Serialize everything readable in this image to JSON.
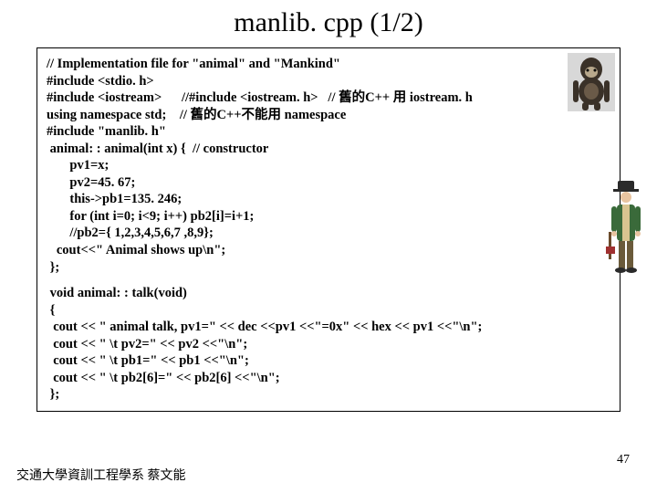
{
  "title": "manlib. cpp (1/2)",
  "code": {
    "l1": "// Implementation file for \"animal\" and \"Mankind\"",
    "l2": "#include <stdio. h>",
    "l3": "#include <iostream>      //#include <iostream. h>   // 舊的C++ 用 iostream. h",
    "l4": "using namespace std;    // 舊的C++不能用 namespace",
    "l5": "#include \"manlib. h\"",
    "l6": " animal: : animal(int x) {  // constructor",
    "l7": "       pv1=x;",
    "l8": "       pv2=45. 67;",
    "l9": "       this->pb1=135. 246;",
    "l10": "       for (int i=0; i<9; i++) pb2[i]=i+1;",
    "l11": "       //pb2={ 1,2,3,4,5,6,7 ,8,9};",
    "l12": "   cout<<\" Animal shows up\\n\";",
    "l13": " };",
    "l14": " void animal: : talk(void)",
    "l15": " {",
    "l16": "  cout << \" animal talk, pv1=\" << dec <<pv1 <<\"=0x\" << hex << pv1 <<\"\\n\";",
    "l17": "  cout << \" \\t pv2=\" << pv2 <<\"\\n\";",
    "l18": "  cout << \" \\t pb1=\" << pb1 <<\"\\n\";",
    "l19": "  cout << \" \\t pb2[6]=\" << pb2[6] <<\"\\n\";",
    "l20": " };"
  },
  "pagenum": "47",
  "footer": "交通大學資訓工程學系 蔡文能"
}
